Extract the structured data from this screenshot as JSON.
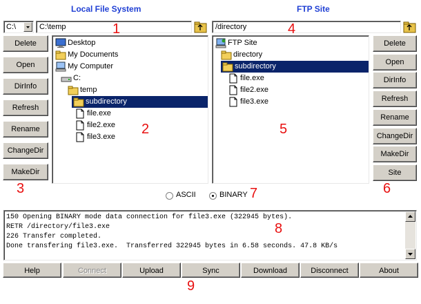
{
  "headers": {
    "local": "Local File System",
    "remote": "FTP Site"
  },
  "local": {
    "drive": "C:\\",
    "path": "C:\\temp",
    "buttons": [
      "Delete",
      "Open",
      "DirInfo",
      "Refresh",
      "Rename",
      "ChangeDir",
      "MakeDir"
    ],
    "tree": [
      {
        "label": "Desktop",
        "icon": "desktop-icon",
        "selected": false
      },
      {
        "label": "My Documents",
        "icon": "folder-icon",
        "selected": false
      },
      {
        "label": "My Computer",
        "icon": "computer-icon",
        "selected": false
      },
      {
        "label": "C:",
        "icon": "drive-icon",
        "selected": false
      },
      {
        "label": "temp",
        "icon": "folder-icon",
        "selected": false
      },
      {
        "label": "subdirectory",
        "icon": "folder-icon",
        "selected": true
      },
      {
        "label": "file.exe",
        "icon": "file-icon",
        "selected": false
      },
      {
        "label": "file2.exe",
        "icon": "file-icon",
        "selected": false
      },
      {
        "label": "file3.exe",
        "icon": "file-icon",
        "selected": false
      }
    ]
  },
  "remote": {
    "path": "/directory",
    "buttons": [
      "Delete",
      "Open",
      "DirInfo",
      "Refresh",
      "Rename",
      "ChangeDir",
      "MakeDir",
      "Site"
    ],
    "tree": [
      {
        "label": "FTP Site",
        "icon": "ftp-site-icon",
        "selected": false
      },
      {
        "label": "directory",
        "icon": "folder-icon",
        "selected": false
      },
      {
        "label": "subdirectory",
        "icon": "folder-icon",
        "selected": true
      },
      {
        "label": "file.exe",
        "icon": "file-icon",
        "selected": false
      },
      {
        "label": "file2.exe",
        "icon": "file-icon",
        "selected": false
      },
      {
        "label": "file3.exe",
        "icon": "file-icon",
        "selected": false
      }
    ]
  },
  "transfer_mode": {
    "options": [
      "ASCII",
      "BINARY"
    ],
    "selected": "BINARY"
  },
  "log": [
    "150 Opening BINARY mode data connection for file3.exe (322945 bytes).",
    "RETR /directory/file3.exe",
    "226 Transfer completed.",
    "Done transfering file3.exe.  Transferred 322945 bytes in 6.58 seconds. 47.8 KB/s"
  ],
  "bottom_buttons": [
    {
      "label": "Help",
      "enabled": true
    },
    {
      "label": "Connect",
      "enabled": false
    },
    {
      "label": "Upload",
      "enabled": true
    },
    {
      "label": "Sync",
      "enabled": true
    },
    {
      "label": "Download",
      "enabled": true
    },
    {
      "label": "Disconnect",
      "enabled": true
    },
    {
      "label": "About",
      "enabled": true
    }
  ],
  "callouts": [
    "1",
    "2",
    "3",
    "4",
    "5",
    "6",
    "7",
    "8",
    "9"
  ],
  "colors": {
    "header": "#1f3fd4",
    "callout": "#e81010",
    "selection": "#0a246a",
    "button_face": "#d4d0c8"
  }
}
